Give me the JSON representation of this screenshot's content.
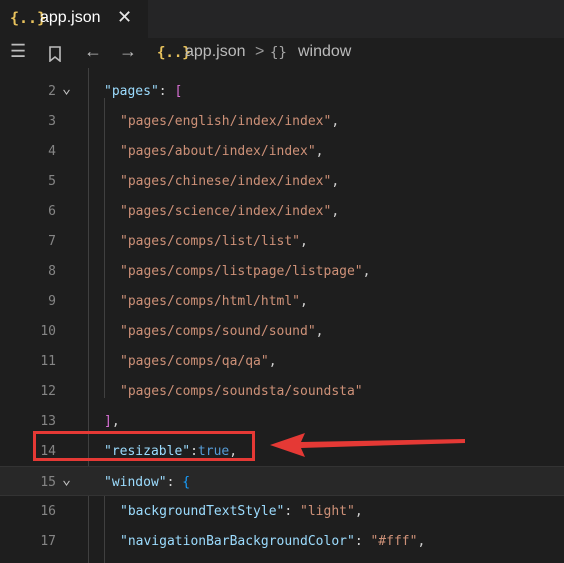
{
  "tab": {
    "icon": "{..}",
    "label": "app.json",
    "close": "✕"
  },
  "breadcrumb": {
    "list_icon": "☰",
    "bookmark_icon": "🔖",
    "back_icon": "←",
    "forward_icon": "→",
    "file_icon": "{..}",
    "file": "app.json",
    "separator": ">",
    "object_icon": "{}",
    "section": "window"
  },
  "lines": [
    {
      "n": "2",
      "parts": [
        [
          "tok-key",
          "\"pages\""
        ],
        [
          "tok-punc",
          ": "
        ],
        [
          "tok-bracket",
          "["
        ]
      ]
    },
    {
      "n": "3",
      "parts": [
        [
          "tok-str",
          "\"pages/english/index/index\""
        ],
        [
          "tok-punc",
          ","
        ]
      ]
    },
    {
      "n": "4",
      "parts": [
        [
          "tok-str",
          "\"pages/about/index/index\""
        ],
        [
          "tok-punc",
          ","
        ]
      ]
    },
    {
      "n": "5",
      "parts": [
        [
          "tok-str",
          "\"pages/chinese/index/index\""
        ],
        [
          "tok-punc",
          ","
        ]
      ]
    },
    {
      "n": "6",
      "parts": [
        [
          "tok-str",
          "\"pages/science/index/index\""
        ],
        [
          "tok-punc",
          ","
        ]
      ]
    },
    {
      "n": "7",
      "parts": [
        [
          "tok-str",
          "\"pages/comps/list/list\""
        ],
        [
          "tok-punc",
          ","
        ]
      ]
    },
    {
      "n": "8",
      "parts": [
        [
          "tok-str",
          "\"pages/comps/listpage/listpage\""
        ],
        [
          "tok-punc",
          ","
        ]
      ]
    },
    {
      "n": "9",
      "parts": [
        [
          "tok-str",
          "\"pages/comps/html/html\""
        ],
        [
          "tok-punc",
          ","
        ]
      ]
    },
    {
      "n": "10",
      "parts": [
        [
          "tok-str",
          "\"pages/comps/sound/sound\""
        ],
        [
          "tok-punc",
          ","
        ]
      ]
    },
    {
      "n": "11",
      "parts": [
        [
          "tok-str",
          "\"pages/comps/qa/qa\""
        ],
        [
          "tok-punc",
          ","
        ]
      ]
    },
    {
      "n": "12",
      "parts": [
        [
          "tok-str",
          "\"pages/comps/soundsta/soundsta\""
        ]
      ]
    },
    {
      "n": "13",
      "parts": [
        [
          "tok-bracket",
          "]"
        ],
        [
          "tok-punc",
          ","
        ]
      ]
    },
    {
      "n": "14",
      "parts": [
        [
          "tok-key",
          "\"resizable\""
        ],
        [
          "tok-punc",
          ":"
        ],
        [
          "tok-bool",
          "true"
        ],
        [
          "tok-punc",
          ","
        ]
      ]
    },
    {
      "n": "15",
      "parts": [
        [
          "tok-key",
          "\"window\""
        ],
        [
          "tok-punc",
          ": "
        ],
        [
          "tok-bracket-b",
          "{"
        ]
      ]
    },
    {
      "n": "16",
      "parts": [
        [
          "tok-key",
          "\"backgroundTextStyle\""
        ],
        [
          "tok-punc",
          ": "
        ],
        [
          "tok-str",
          "\"light\""
        ],
        [
          "tok-punc",
          ","
        ]
      ]
    },
    {
      "n": "17",
      "parts": [
        [
          "tok-key",
          "\"navigationBarBackgroundColor\""
        ],
        [
          "tok-punc",
          ": "
        ],
        [
          "tok-str",
          "\"#fff\""
        ],
        [
          "tok-punc",
          ","
        ]
      ]
    }
  ],
  "annotation": {
    "color": "#e53935"
  }
}
